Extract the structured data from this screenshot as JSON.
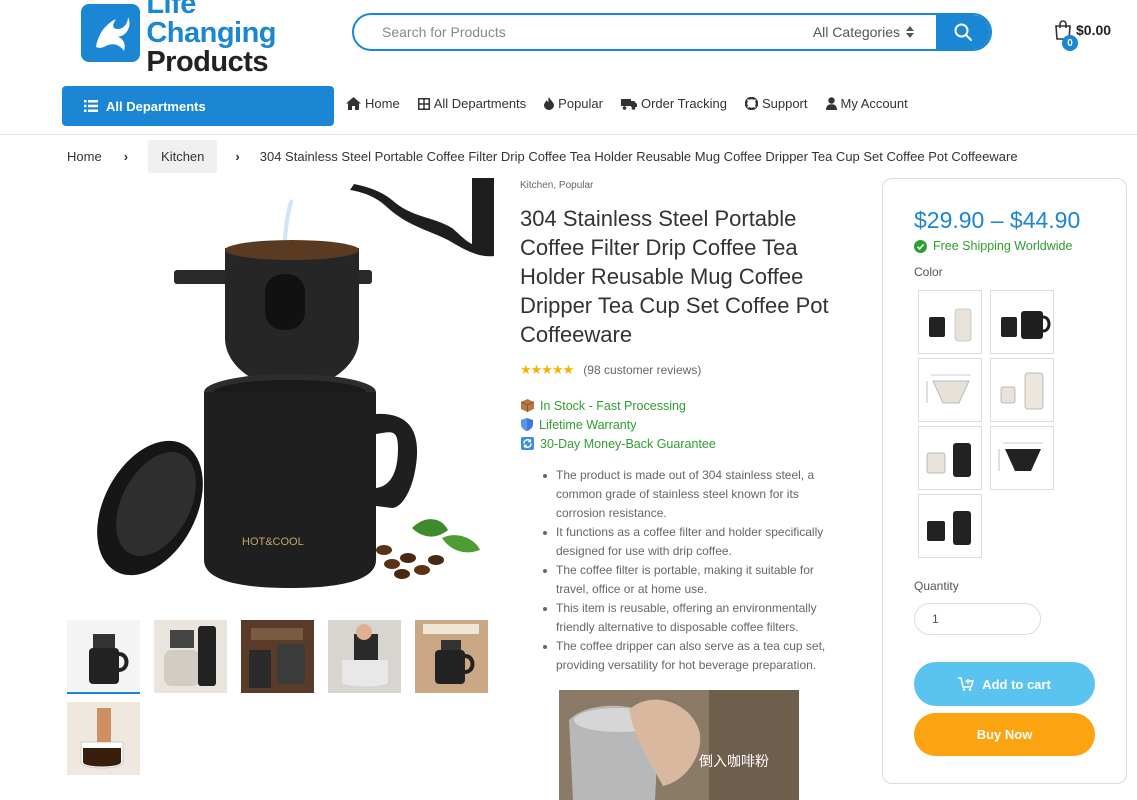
{
  "header": {
    "logo_line1": "Life Changing",
    "logo_line2": "Products",
    "search_placeholder": "Search for Products",
    "search_category": "All Categories",
    "cart_count": "0",
    "cart_total": "$0.00"
  },
  "nav": {
    "departments_button": "All Departments",
    "items": [
      {
        "label": "Home",
        "icon": "home-icon"
      },
      {
        "label": "All Departments",
        "icon": "grid-icon"
      },
      {
        "label": "Popular",
        "icon": "fire-icon"
      },
      {
        "label": "Order Tracking",
        "icon": "truck-icon"
      },
      {
        "label": "Support",
        "icon": "lifebuoy-icon"
      },
      {
        "label": "My Account",
        "icon": "user-icon"
      }
    ]
  },
  "breadcrumb": {
    "home": "Home",
    "category": "Kitchen",
    "current": "304 Stainless Steel Portable Coffee Filter Drip Coffee Tea Holder Reusable Mug Coffee Dripper Tea Cup Set Coffee Pot Coffeeware"
  },
  "gallery": {
    "main_image_text": "HOT&COOL",
    "thumbnail_count": 6,
    "video_caption": "倒入咖啡粉"
  },
  "product": {
    "categories": "Kitchen, Popular",
    "title": "304 Stainless Steel Portable Coffee Filter Drip Coffee Tea Holder Reusable Mug Coffee Dripper Tea Cup Set Coffee Pot Coffeeware",
    "rating": 5,
    "reviews": "(98 customer reviews)",
    "features": [
      {
        "text": "In Stock - Fast Processing",
        "icon": "box-icon"
      },
      {
        "text": "Lifetime Warranty",
        "icon": "shield-icon"
      },
      {
        "text": "30-Day Money-Back Guarantee",
        "icon": "refresh-icon"
      }
    ],
    "description": [
      "The product is made out of 304 stainless steel, a common grade of stainless steel known for its corrosion resistance.",
      "It functions as a coffee filter and holder specifically designed for use with drip coffee.",
      "The coffee filter is portable, making it suitable for travel, office or at home use.",
      "This item is reusable, offering an environmentally friendly alternative to disposable coffee filters.",
      "The coffee dripper can also serve as a tea cup set, providing versatility for hot beverage preparation."
    ]
  },
  "purchase": {
    "price": "$29.90 – $44.90",
    "shipping": "Free Shipping Worldwide",
    "color_label": "Color",
    "swatch_count": 7,
    "quantity_label": "Quantity",
    "quantity_value": "1",
    "add_to_cart": "Add to cart",
    "buy_now": "Buy Now"
  },
  "colors": {
    "brand": "#1a86d4",
    "success": "#2e9e2e",
    "cart_button": "#5bc3f0",
    "buy_button": "#fca311",
    "star": "#f5b301"
  }
}
